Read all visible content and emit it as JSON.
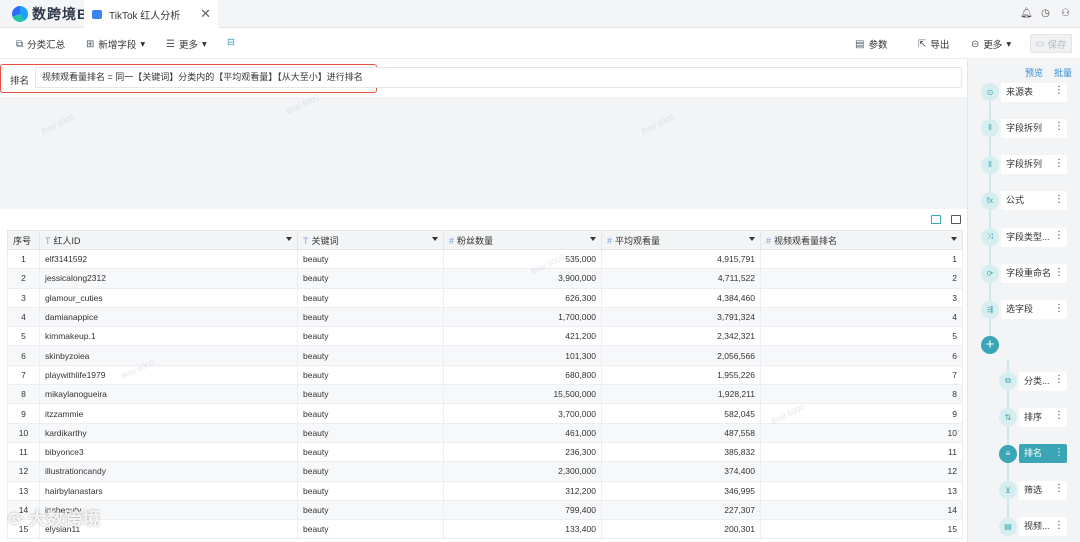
{
  "app": {
    "logo_text": "数跨境BI",
    "tab_title": "TikTok 红人分析"
  },
  "toolbar": {
    "group_summary": "分类汇总",
    "add_field": "新增字段",
    "more_left": "更多",
    "params": "参数",
    "export": "导出",
    "more_right": "更多",
    "save": "保存"
  },
  "formula": {
    "label": "排名",
    "text": "视频观看量排名 = 同一【关键词】分类内的【平均观看量】【从大至小】进行排名"
  },
  "table": {
    "headers": [
      "序号",
      "红人ID",
      "关键词",
      "粉丝数量",
      "平均观看量",
      "视频观看量排名"
    ],
    "rows": [
      [
        "1",
        "elf3141592",
        "beauty",
        "535,000",
        "4,915,791",
        "1"
      ],
      [
        "2",
        "jessicalong2312",
        "beauty",
        "3,900,000",
        "4,711,522",
        "2"
      ],
      [
        "3",
        "glamour_cuties",
        "beauty",
        "626,300",
        "4,384,460",
        "3"
      ],
      [
        "4",
        "damianappice",
        "beauty",
        "1,700,000",
        "3,791,324",
        "4"
      ],
      [
        "5",
        "kimmakeup.1",
        "beauty",
        "421,200",
        "2,342,321",
        "5"
      ],
      [
        "6",
        "skinbyzoiea",
        "beauty",
        "101,300",
        "2,056,566",
        "6"
      ],
      [
        "7",
        "playwithlife1979",
        "beauty",
        "680,800",
        "1,955,226",
        "7"
      ],
      [
        "8",
        "mikaylanogueira",
        "beauty",
        "15,500,000",
        "1,928,211",
        "8"
      ],
      [
        "9",
        "itzzammie",
        "beauty",
        "3,700,000",
        "582,045",
        "9"
      ],
      [
        "10",
        "kardikarthy",
        "beauty",
        "461,000",
        "487,558",
        "10"
      ],
      [
        "11",
        "bibyonce3",
        "beauty",
        "236,300",
        "385,832",
        "11"
      ],
      [
        "12",
        "illustrationcandy",
        "beauty",
        "2,300,000",
        "374,400",
        "12"
      ],
      [
        "13",
        "hairbylanastars",
        "beauty",
        "312,200",
        "346,995",
        "13"
      ],
      [
        "14",
        "ipsbeauty",
        "beauty",
        "799,400",
        "227,307",
        "14"
      ],
      [
        "15",
        "elysian11",
        "beauty",
        "133,400",
        "200,301",
        "15"
      ]
    ]
  },
  "panel": {
    "preview": "预览",
    "batch": "批量",
    "steps": [
      "来源表",
      "字段拆列",
      "字段拆列",
      "公式",
      "字段类型...",
      "字段重命名",
      "选字段"
    ],
    "branch_steps": [
      "分类...",
      "排序",
      "排名",
      "筛选",
      "视频..."
    ]
  },
  "watermark": {
    "brand": "大数跨境",
    "tag": "Bital 6000"
  }
}
